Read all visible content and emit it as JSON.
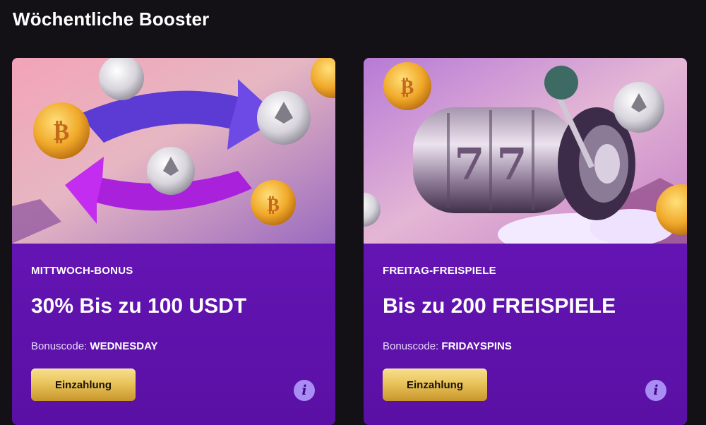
{
  "page": {
    "title": "Wöchentliche Booster"
  },
  "cards": [
    {
      "tag": "MITTWOCH-BONUS",
      "headline": "30% Bis zu 100 USDT",
      "code_label": "Bonuscode: ",
      "code_value": "WEDNESDAY",
      "button_label": "Einzahlung",
      "info_glyph": "i",
      "image": "crypto-exchange-arrows-coins"
    },
    {
      "tag": "FREITAG-FREISPIELE",
      "headline": "Bis zu 200 FREISPIELE",
      "code_label": "Bonuscode: ",
      "code_value": "FRIDAYSPINS",
      "button_label": "Einzahlung",
      "info_glyph": "i",
      "image": "slot-machine-reels-777"
    }
  ],
  "colors": {
    "background": "#131016",
    "card_purple": "#5d12a8",
    "button_gold": "#e9c45c",
    "info_icon": "#a98cf4"
  }
}
